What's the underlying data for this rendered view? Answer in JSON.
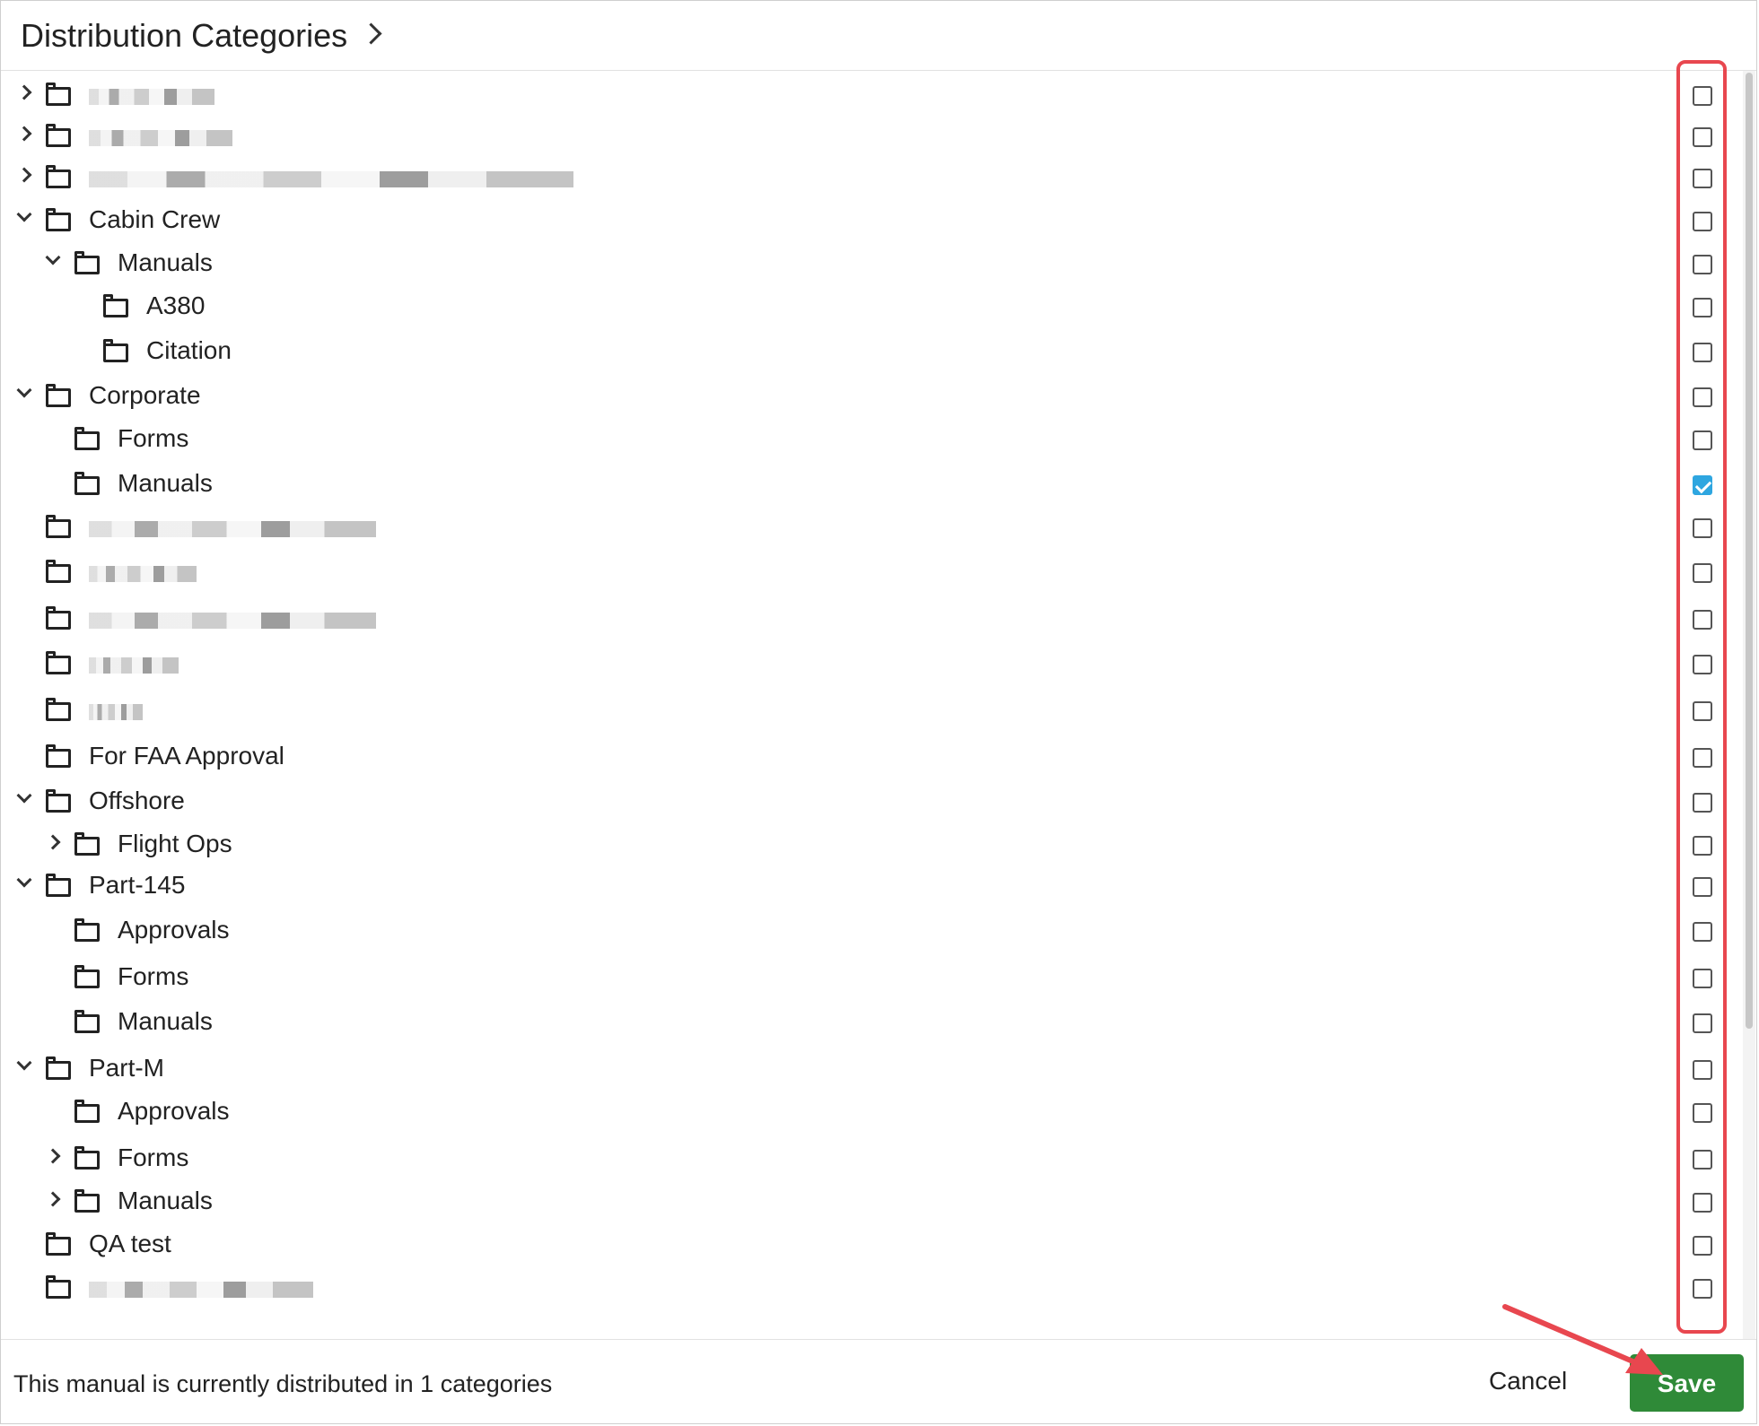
{
  "dialog": {
    "title": "Distribution Categories"
  },
  "tree": [
    {
      "level": 0,
      "expand": "collapsed",
      "label": "",
      "redacted": true,
      "blur_width": 140,
      "checked": false
    },
    {
      "level": 0,
      "expand": "collapsed",
      "label": "",
      "redacted": true,
      "blur_width": 160,
      "checked": false
    },
    {
      "level": 0,
      "expand": "collapsed",
      "label": "",
      "redacted": true,
      "blur_width": 540,
      "checked": false
    },
    {
      "level": 0,
      "expand": "expanded",
      "label": "Cabin Crew",
      "redacted": false,
      "checked": false
    },
    {
      "level": 1,
      "expand": "expanded",
      "label": "Manuals",
      "redacted": false,
      "checked": false
    },
    {
      "level": 2,
      "expand": "none",
      "label": "A380",
      "redacted": false,
      "checked": false
    },
    {
      "level": 2,
      "expand": "none",
      "label": "Citation",
      "redacted": false,
      "checked": false
    },
    {
      "level": 0,
      "expand": "expanded",
      "label": "Corporate",
      "redacted": false,
      "checked": false
    },
    {
      "level": 1,
      "expand": "none",
      "label": "Forms",
      "redacted": false,
      "checked": false
    },
    {
      "level": 1,
      "expand": "none",
      "label": "Manuals",
      "redacted": false,
      "checked": true
    },
    {
      "level": 0,
      "expand": "none",
      "label": "",
      "redacted": true,
      "blur_width": 320,
      "checked": false
    },
    {
      "level": 0,
      "expand": "none",
      "label": "",
      "redacted": true,
      "blur_width": 120,
      "checked": false
    },
    {
      "level": 0,
      "expand": "none",
      "label": "",
      "redacted": true,
      "blur_width": 320,
      "checked": false
    },
    {
      "level": 0,
      "expand": "none",
      "label": "",
      "redacted": true,
      "blur_width": 100,
      "checked": false
    },
    {
      "level": 0,
      "expand": "none",
      "label": "",
      "redacted": true,
      "blur_width": 60,
      "checked": false
    },
    {
      "level": 0,
      "expand": "none",
      "label": "For FAA Approval",
      "redacted": false,
      "checked": false
    },
    {
      "level": 0,
      "expand": "expanded",
      "label": "Offshore",
      "redacted": false,
      "checked": false
    },
    {
      "level": 1,
      "expand": "collapsed",
      "label": "Flight Ops",
      "redacted": false,
      "checked": false
    },
    {
      "level": 0,
      "expand": "expanded",
      "label": "Part-145",
      "redacted": false,
      "checked": false
    },
    {
      "level": 1,
      "expand": "none",
      "label": "Approvals",
      "redacted": false,
      "checked": false
    },
    {
      "level": 1,
      "expand": "none",
      "label": "Forms",
      "redacted": false,
      "checked": false
    },
    {
      "level": 1,
      "expand": "none",
      "label": "Manuals",
      "redacted": false,
      "checked": false
    },
    {
      "level": 0,
      "expand": "expanded",
      "label": "Part-M",
      "redacted": false,
      "checked": false
    },
    {
      "level": 1,
      "expand": "none",
      "label": "Approvals",
      "redacted": false,
      "checked": false
    },
    {
      "level": 1,
      "expand": "collapsed",
      "label": "Forms",
      "redacted": false,
      "checked": false
    },
    {
      "level": 1,
      "expand": "collapsed",
      "label": "Manuals",
      "redacted": false,
      "checked": false
    },
    {
      "level": 0,
      "expand": "none",
      "label": "QA test",
      "redacted": false,
      "checked": false
    },
    {
      "level": 0,
      "expand": "none",
      "label": "",
      "redacted": true,
      "blur_width": 250,
      "checked": false
    }
  ],
  "footer": {
    "status": "This manual is currently distributed in 1 categories",
    "cancel_label": "Cancel",
    "save_label": "Save"
  },
  "colors": {
    "save_bg": "#2f8a38",
    "highlight": "#e8474f",
    "checked": "#2ea6e0"
  },
  "icons": {
    "folder": "folder-icon",
    "expand": "chevron-right-icon",
    "collapse": "chevron-down-icon",
    "breadcrumb": "chevron-right-icon"
  }
}
